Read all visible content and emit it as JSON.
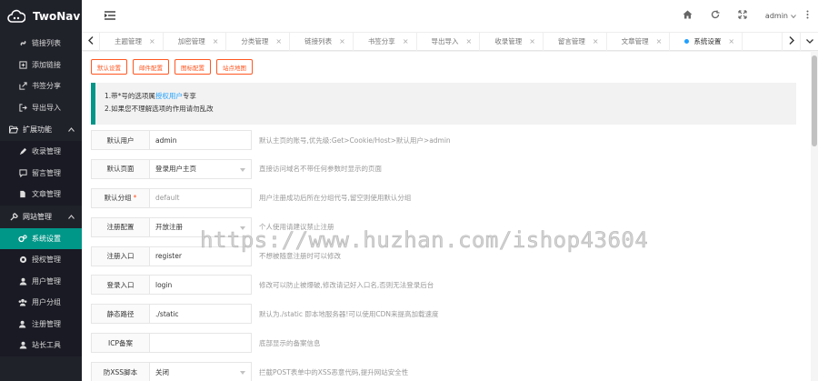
{
  "app": {
    "logo_text": "TwoNav"
  },
  "sidebar": {
    "items": [
      {
        "label": "链接列表",
        "icon": "link-icon"
      },
      {
        "label": "添加链接",
        "icon": "plus-square-icon"
      },
      {
        "label": "书签分享",
        "icon": "share-icon"
      },
      {
        "label": "导出导入",
        "icon": "sign-out-icon"
      }
    ],
    "groups": [
      {
        "label": "扩展功能",
        "icon": "folder-open-icon",
        "items": [
          {
            "label": "收录管理",
            "icon": "pencil-icon"
          },
          {
            "label": "留言管理",
            "icon": "comment-icon"
          },
          {
            "label": "文章管理",
            "icon": "file-icon"
          }
        ]
      },
      {
        "label": "网站管理",
        "icon": "wrench-icon",
        "items": [
          {
            "label": "系统设置",
            "icon": "gears-icon",
            "active": true
          },
          {
            "label": "授权管理",
            "icon": "certificate-icon"
          },
          {
            "label": "用户管理",
            "icon": "user-icon"
          },
          {
            "label": "用户分组",
            "icon": "users-icon"
          },
          {
            "label": "注册管理",
            "icon": "user-plus-icon"
          },
          {
            "label": "站长工具",
            "icon": "tools-icon"
          }
        ]
      }
    ]
  },
  "header": {
    "user": "admin"
  },
  "tabs": [
    {
      "label": "主题管理"
    },
    {
      "label": "加密管理"
    },
    {
      "label": "分类管理"
    },
    {
      "label": "链接列表"
    },
    {
      "label": "书签分享"
    },
    {
      "label": "导出导入"
    },
    {
      "label": "收录管理"
    },
    {
      "label": "留言管理"
    },
    {
      "label": "文章管理"
    },
    {
      "label": "系统设置",
      "active": true
    }
  ],
  "subtabs": [
    "默认设置",
    "邮件配置",
    "图标配置",
    "站点地图"
  ],
  "notice": {
    "line1_prefix": "1.带*号的选项属",
    "line1_link": "授权用户",
    "line1_suffix": "专享",
    "line2": "2.如果您不理解选项的作用请勿乱改"
  },
  "form": [
    {
      "label": "默认用户",
      "value": "admin",
      "help": "默认主页的账号,优先级:Get>Cookie/Host>默认用户>admin"
    },
    {
      "label": "默认页面",
      "value": "登录用户主页",
      "select": true,
      "help": "直接访问域名不带任何参数时显示的页面"
    },
    {
      "label": "默认分组",
      "required": "*",
      "value": "default",
      "placeholder": true,
      "help": "用户注册成功后所在分组代号,留空则使用默认分组"
    },
    {
      "label": "注册配置",
      "value": "开放注册",
      "select": true,
      "help": "个人使用请建议禁止注册"
    },
    {
      "label": "注册入口",
      "value": "register",
      "help": "不想被随意注册时可以修改"
    },
    {
      "label": "登录入口",
      "value": "login",
      "help": "修改可以防止被爆破,修改请记好入口名,否则无法登录后台"
    },
    {
      "label": "静态路径",
      "value": "./static",
      "help": "默认为./static 即本地服务器!可以使用CDN来提高加载速度"
    },
    {
      "label": "ICP备案",
      "value": "",
      "help": "底部显示的备案信息"
    },
    {
      "label": "防XSS脚本",
      "value": "关闭",
      "select": true,
      "help": "拦截POST表单中的XSS恶意代码,提升网站安全性"
    }
  ],
  "watermark": "https://www.huzhan.com/ishop43604",
  "colors": {
    "sidebar_bg": "#20222a",
    "active": "#009688",
    "accent_orange": "#ff5722",
    "link_blue": "#1e9fff"
  }
}
